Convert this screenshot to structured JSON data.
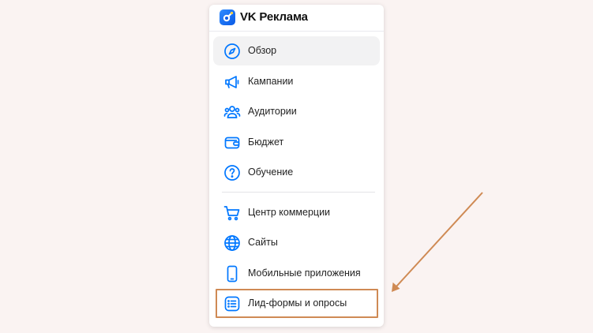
{
  "app": {
    "title": "VK Реклама",
    "logo_icon": "vk-ads-logo-icon"
  },
  "menu": {
    "primary": [
      {
        "label": "Обзор",
        "icon": "compass-icon",
        "active": true
      },
      {
        "label": "Кампании",
        "icon": "megaphone-icon"
      },
      {
        "label": "Аудитории",
        "icon": "users-icon"
      },
      {
        "label": "Бюджет",
        "icon": "wallet-icon"
      },
      {
        "label": "Обучение",
        "icon": "question-icon"
      }
    ],
    "secondary": [
      {
        "label": "Центр коммерции",
        "icon": "cart-icon"
      },
      {
        "label": "Сайты",
        "icon": "globe-icon"
      },
      {
        "label": "Мобильные приложения",
        "icon": "smartphone-icon"
      },
      {
        "label": "Лид-формы и опросы",
        "icon": "list-icon",
        "highlighted": true
      }
    ]
  },
  "colors": {
    "accent": "#0077ff",
    "background": "#faf3f2",
    "active_item": "#f2f2f3",
    "annotation": "#cf8a54"
  }
}
